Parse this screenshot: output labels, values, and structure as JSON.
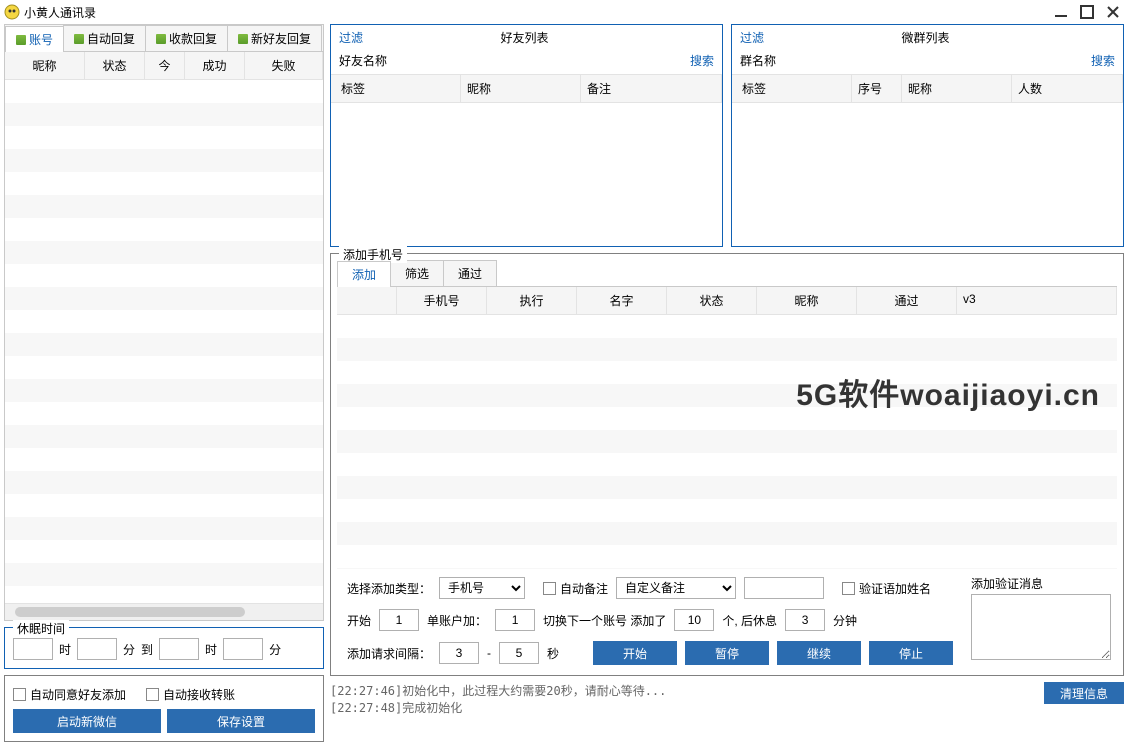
{
  "app": {
    "title": "小黄人通讯录"
  },
  "leftTabs": [
    "账号",
    "自动回复",
    "收款回复",
    "新好友回复"
  ],
  "accountTable": {
    "headers": [
      "昵称",
      "状态",
      "今",
      "成功",
      "失败"
    ]
  },
  "friends": {
    "filter": "过滤",
    "title": "好友列表",
    "nameLabel": "好友名称",
    "search": "搜索",
    "headers": [
      "标签",
      "昵称",
      "备注"
    ]
  },
  "groups": {
    "filter": "过滤",
    "title": "微群列表",
    "nameLabel": "群名称",
    "search": "搜索",
    "headers": [
      "标签",
      "序号",
      "昵称",
      "人数"
    ]
  },
  "addPhone": {
    "legend": "添加手机号",
    "tabs": [
      "添加",
      "筛选",
      "通过"
    ],
    "headers": [
      "手机号",
      "执行",
      "名字",
      "状态",
      "昵称",
      "通过",
      "v3"
    ]
  },
  "controls": {
    "selectTypeLabel": "选择添加类型：",
    "selectTypeValue": "手机号",
    "autoRemark": "自动备注",
    "customRemarkValue": "自定义备注",
    "verifyAppendName": "验证语加姓名",
    "addVerifyMsgLabel": "添加验证消息",
    "startLabel": "开始",
    "startVal": "1",
    "perAccountLabel": "单账户加：",
    "perAccountVal": "1",
    "switchLabel": "切换下一个账号 添加了",
    "switchVal": "10",
    "restLabel1": "个, 后休息",
    "restVal": "3",
    "restLabel2": "分钟",
    "intervalLabel": "添加请求间隔：",
    "intervalFrom": "3",
    "intervalSep": "-",
    "intervalTo": "5",
    "secLabel": "秒",
    "btnStart": "开始",
    "btnPause": "暂停",
    "btnContinue": "继续",
    "btnStop": "停止"
  },
  "sleep": {
    "legend": "休眠时间",
    "hour1": "时",
    "min1": "分",
    "to": "到",
    "hour2": "时",
    "min2": "分"
  },
  "bottom": {
    "autoAcceptFriend": "自动同意好友添加",
    "autoAcceptTransfer": "自动接收转账",
    "btnNewWechat": "启动新微信",
    "btnSaveSettings": "保存设置"
  },
  "log": {
    "lines": "[22:27:46]初始化中，此过程大约需要20秒，请耐心等待...\n[22:27:48]完成初始化",
    "clear": "清理信息"
  },
  "watermark": "5G软件woaijiaoyi.cn"
}
